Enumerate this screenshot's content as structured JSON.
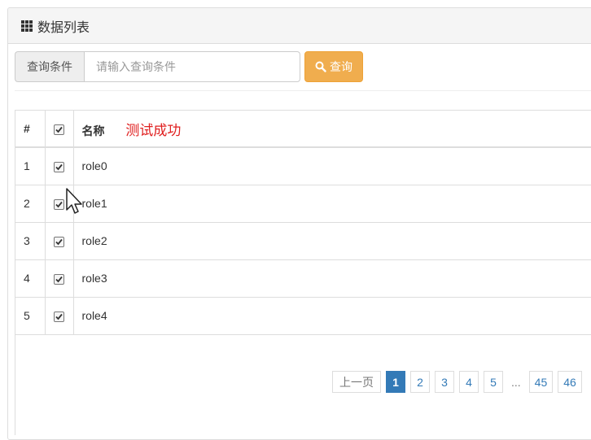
{
  "header": {
    "title": "数据列表",
    "icon": "grid-icon"
  },
  "search": {
    "addon_label": "查询条件",
    "placeholder": "请输入查询条件",
    "value": "",
    "button_label": "查询",
    "button_icon": "search-icon",
    "button_color": "#f0ad4e"
  },
  "table": {
    "headers": {
      "number": "#",
      "name": "名称"
    },
    "header_checked": true,
    "success_message": "测试成功",
    "success_color": "#e02020",
    "rows": [
      {
        "number": "1",
        "checked": true,
        "name": "role0"
      },
      {
        "number": "2",
        "checked": true,
        "name": "role1"
      },
      {
        "number": "3",
        "checked": true,
        "name": "role2"
      },
      {
        "number": "4",
        "checked": true,
        "name": "role3"
      },
      {
        "number": "5",
        "checked": true,
        "name": "role4"
      }
    ]
  },
  "pagination": {
    "prev_label": "上一页",
    "pages": [
      "1",
      "2",
      "3",
      "4",
      "5"
    ],
    "active_page": "1",
    "ellipsis": "...",
    "tail_pages": [
      "45",
      "46"
    ],
    "active_color": "#337ab7"
  }
}
